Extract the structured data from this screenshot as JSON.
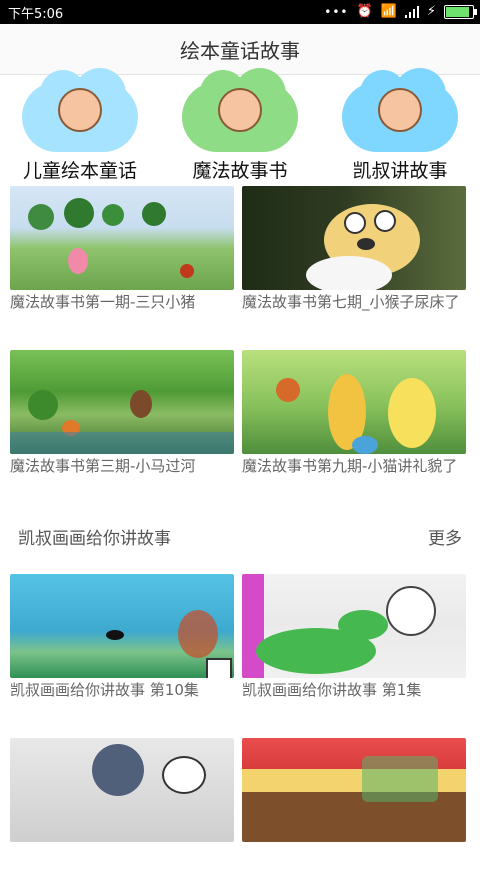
{
  "status": {
    "time": "下午5:06",
    "battery_level": 0.82
  },
  "app": {
    "title": "绘本童话故事"
  },
  "categories": [
    {
      "label": "儿童绘本童话",
      "color": "#a6e3ff",
      "icon": "boy-pencil-icon"
    },
    {
      "label": "魔法故事书",
      "color": "#8fdc86",
      "icon": "girl-reading-icon"
    },
    {
      "label": "凯叔讲故事",
      "color": "#7fd6ff",
      "icon": "boy-book-icon"
    }
  ],
  "stories": [
    {
      "caption": "魔法故事书第一期-三只小猪"
    },
    {
      "caption": "魔法故事书第七期_小猴子尿床了"
    },
    {
      "caption": "魔法故事书第三期-小马过河"
    },
    {
      "caption": "魔法故事书第九期-小猫讲礼貌了"
    }
  ],
  "section": {
    "title": "凯叔画画给你讲故事",
    "more_label": "更多",
    "items": [
      {
        "caption": "凯叔画画给你讲故事 第10集"
      },
      {
        "caption": "凯叔画画给你讲故事 第1集"
      },
      {
        "caption": ""
      },
      {
        "caption": ""
      }
    ]
  }
}
